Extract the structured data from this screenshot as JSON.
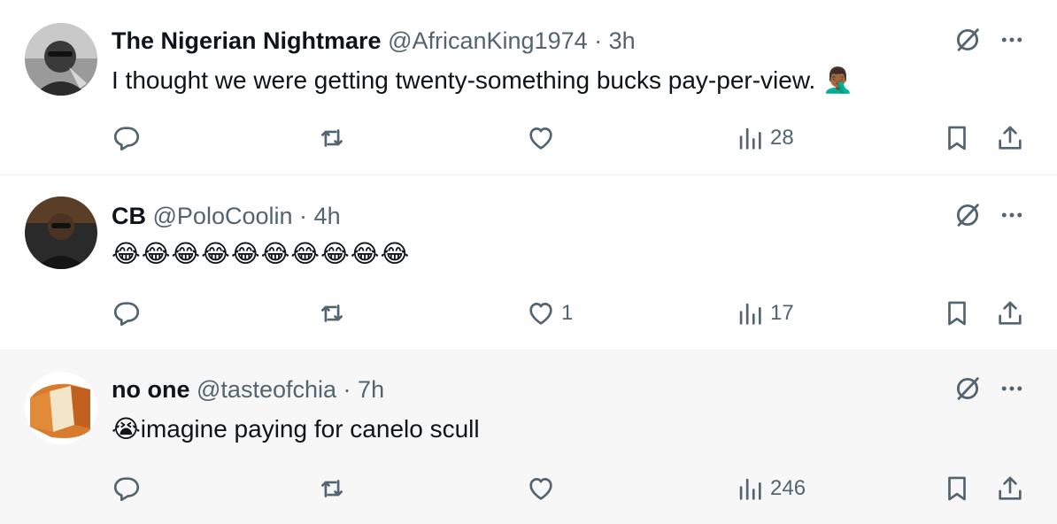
{
  "colors": {
    "text_primary": "#0f1419",
    "text_secondary": "#536471",
    "divider": "#eff3f4",
    "highlight_bg": "#f7f7f7"
  },
  "tweets": [
    {
      "display_name": "The Nigerian Nightmare",
      "handle": "@AfricanKing1974",
      "separator": "·",
      "time": "3h",
      "text": "I thought we were getting twenty-something bucks pay-per-view. 🤦🏾‍♂️",
      "reply_count": "",
      "retweet_count": "",
      "like_count": "",
      "views": "28",
      "icons": [
        "grok-icon",
        "more-icon",
        "reply-icon",
        "retweet-icon",
        "like-icon",
        "views-icon",
        "bookmark-icon",
        "share-icon"
      ]
    },
    {
      "display_name": "CB",
      "handle": "@PoloCoolin",
      "separator": "·",
      "time": "4h",
      "text": "😂😂😂😂😂😂😂😂😂😂",
      "reply_count": "",
      "retweet_count": "",
      "like_count": "1",
      "views": "17",
      "icons": [
        "grok-icon",
        "more-icon",
        "reply-icon",
        "retweet-icon",
        "like-icon",
        "views-icon",
        "bookmark-icon",
        "share-icon"
      ]
    },
    {
      "display_name": "no one",
      "handle": "@tasteofchia",
      "separator": "·",
      "time": "7h",
      "text": "😭imagine paying for canelo scull",
      "reply_count": "",
      "retweet_count": "",
      "like_count": "",
      "views": "246",
      "icons": [
        "grok-icon",
        "more-icon",
        "reply-icon",
        "retweet-icon",
        "like-icon",
        "views-icon",
        "bookmark-icon",
        "share-icon"
      ]
    }
  ]
}
